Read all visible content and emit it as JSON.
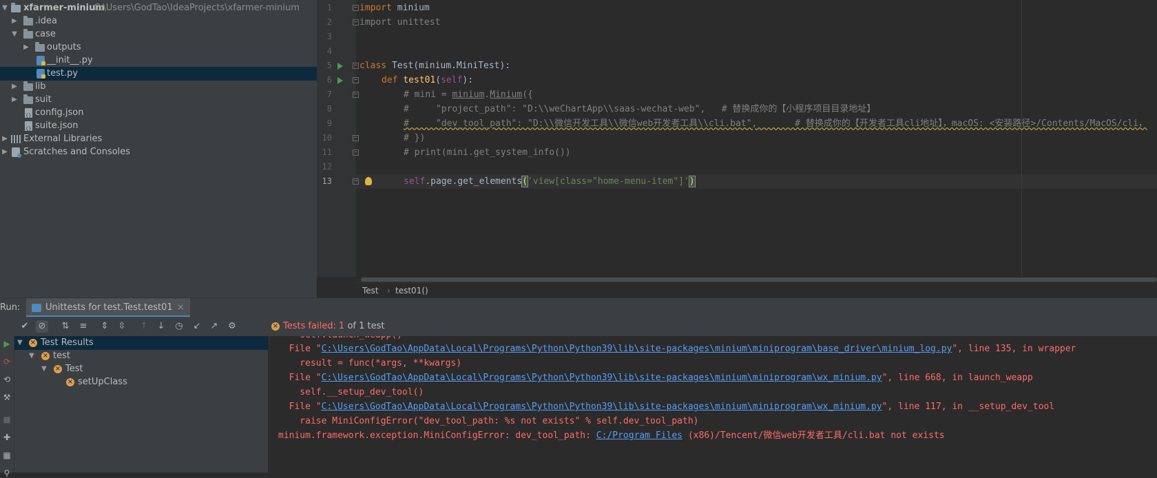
{
  "project_tree": {
    "root_name": "xfarmer-minium",
    "root_path": "C:\\Users\\GodTao\\IdeaProjects\\xfarmer-minium",
    "items": [
      {
        "label": ".idea"
      },
      {
        "label": "case"
      },
      {
        "label": "outputs"
      },
      {
        "label": "__init__.py"
      },
      {
        "label": "test.py"
      },
      {
        "label": "lib"
      },
      {
        "label": "suit"
      },
      {
        "label": "config.json"
      },
      {
        "label": "suite.json"
      },
      {
        "label": "External Libraries"
      },
      {
        "label": "Scratches and Consoles"
      }
    ]
  },
  "editor": {
    "line_numbers": [
      "1",
      "2",
      "3",
      "4",
      "5",
      "6",
      "7",
      "8",
      "9",
      "10",
      "11",
      "12",
      "13"
    ],
    "l1_kw": "import",
    "l1_rest": " minium",
    "l2_kw": "import",
    "l2_rest": " unittest",
    "l5_kw": "class",
    "l5_rest": " Test(minium.MiniTest):",
    "l6_kw": "def",
    "l6_fn": "test01",
    "l6_open": "(",
    "l6_self": "self",
    "l6_close": "):",
    "l7_a": "# mini = ",
    "l7_b": "minium",
    "l7_c": ".",
    "l7_d": "Minium",
    "l7_e": "({",
    "l8": "#     \"project_path\": \"D:\\\\weChartApp\\\\saas-wechat-web\",   # 替换成你的【小程序项目目录地址】",
    "l9": "#     \"dev_tool_path\": \"D:\\\\微信开发工具\\\\微信web开发者工具\\\\cli.bat\",       # 替换成你的【开发者工具cli地址】，macOS: <安装路径>/Contents/MacOS/cli，",
    "l10": "# })",
    "l11": "# print(mini.get_system_info())",
    "l13_self": "self",
    "l13_a": ".page.get_elements",
    "l13_open": "(",
    "l13_str": "'view[class=\"home-menu-item\"]'",
    "l13_close": ")"
  },
  "breadcrumbs": {
    "class": "Test",
    "sep": "›",
    "method": "test01()"
  },
  "run": {
    "label": "Run:",
    "tab_title": "Unittests for test.Test.test01",
    "tab_close": "×",
    "status_prefix": "Tests failed:",
    "status_count": "1",
    "status_suffix": "of 1 test"
  },
  "results": [
    {
      "label": "Test Results"
    },
    {
      "label": "test"
    },
    {
      "label": "Test"
    },
    {
      "label": "setUpClass"
    }
  ],
  "console": {
    "l0": "    self.launch_weapp()",
    "l1_pre": "  File \"",
    "l1_link": "C:\\Users\\GodTao\\AppData\\Local\\Programs\\Python\\Python39\\lib\\site-packages\\minium\\miniprogram\\base_driver\\minium_log.py",
    "l1_post": "\", line 135, in wrapper",
    "l2": "    result = func(*args, **kwargs)",
    "l3_pre": "  File \"",
    "l3_link": "C:\\Users\\GodTao\\AppData\\Local\\Programs\\Python\\Python39\\lib\\site-packages\\minium\\miniprogram\\wx_minium.py",
    "l3_post": "\", line 668, in launch_weapp",
    "l4": "    self.__setup_dev_tool()",
    "l5_pre": "  File \"",
    "l5_link": "C:\\Users\\GodTao\\AppData\\Local\\Programs\\Python\\Python39\\lib\\site-packages\\minium\\miniprogram\\wx_minium.py",
    "l5_post": "\", line 117, in __setup_dev_tool",
    "l6": "    raise MiniConfigError(\"dev_tool_path: %s not exists\" % self.dev_tool_path)",
    "l7_pre": "minium.framework.exception.MiniConfigError: dev_tool_path: ",
    "l7_link": "C:/Program Files",
    "l7_post": " (x86)/Tencent/微信web开发者工具/cli.bat not exists"
  }
}
